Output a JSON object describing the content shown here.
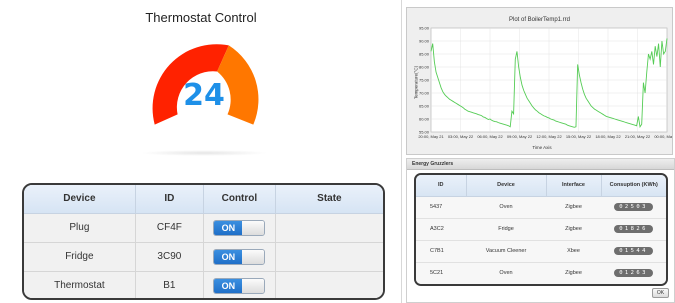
{
  "thermostat": {
    "title": "Thermostat Control",
    "value": "24",
    "gauge_fraction": 0.24
  },
  "device_table": {
    "headers": [
      "Device",
      "ID",
      "Control",
      "State"
    ],
    "rows": [
      {
        "device": "Plug",
        "id": "CF4F",
        "control": "ON",
        "state": ""
      },
      {
        "device": "Fridge",
        "id": "3C90",
        "control": "ON",
        "state": ""
      },
      {
        "device": "Thermostat",
        "id": "B1",
        "control": "ON",
        "state": ""
      }
    ]
  },
  "plot": {
    "title": "Plot of BoilerTemp1.rrd",
    "ylabel": "Temperature(°C)",
    "xlabel": "Time Axis",
    "yticks": [
      "95.00",
      "90.00",
      "85.00",
      "80.00",
      "75.00",
      "70.00",
      "65.00",
      "60.00",
      "55.00"
    ],
    "xticks": [
      "20:00, May 21",
      "03:00, May 22",
      "06:00, May 22",
      "09:00, May 22",
      "12:00, May 22",
      "15:00, May 22",
      "18:00, May 22",
      "21:00, May 22",
      "00:00, May 23"
    ]
  },
  "chart_data": {
    "type": "line",
    "title": "Plot of BoilerTemp1.rrd",
    "xlabel": "Time Axis",
    "ylabel": "Temperature(°C)",
    "ylim": [
      55,
      95
    ],
    "series": [
      {
        "values": [
          86,
          89,
          82,
          78,
          76,
          74,
          72,
          70.5,
          69.5,
          68.8,
          68.2,
          67.6,
          67.2,
          66.8,
          66.4,
          66,
          65.6,
          65.2,
          64.8,
          64.4,
          63.8,
          63.4,
          63,
          62.8,
          62.6,
          62.4,
          62.2,
          62,
          61.7,
          61.5,
          61.3,
          60.8,
          60.6,
          60.2,
          59.8,
          60,
          59.5,
          59.2,
          59,
          58.9,
          58.6,
          58.4,
          58.2,
          58,
          57.8,
          57.6,
          57.4,
          57,
          63,
          62,
          83,
          86,
          80,
          76,
          73,
          71,
          69.5,
          68,
          67,
          66,
          65,
          64.2,
          63.5,
          63,
          62.4,
          62,
          61.6,
          61.2,
          61,
          60.6,
          60.4,
          60,
          59.8,
          59.6,
          59.2,
          59,
          58.8,
          58.6,
          58.4,
          58.2,
          58,
          57.6,
          57.4,
          57.2,
          57,
          56.8,
          57,
          81,
          77,
          74,
          71.5,
          69.5,
          68,
          67,
          66,
          65,
          64.4,
          63.8,
          63.4,
          63,
          62.6,
          62.2,
          61.8,
          61.4,
          61,
          60.8,
          60.6,
          60.4,
          60.2,
          60,
          59.8,
          59.6,
          59.4,
          59.2,
          59,
          58.8,
          58.6,
          58.4,
          58.2,
          58,
          57.8,
          57.6,
          57.4,
          61,
          57,
          58,
          74,
          70,
          78,
          85,
          83,
          86,
          81,
          88,
          84,
          89,
          80,
          90,
          85,
          86,
          91
        ]
      }
    ]
  },
  "energy": {
    "title": "Energy Gruzzlers",
    "headers": [
      "ID",
      "Device",
      "Interface",
      "Consuption (KWh)"
    ],
    "rows": [
      {
        "id": "5437",
        "device": "Oven",
        "interface": "Zigbee",
        "consumption": "02503"
      },
      {
        "id": "A3C2",
        "device": "Fridge",
        "interface": "Zigbee",
        "consumption": "01826"
      },
      {
        "id": "C7B1",
        "device": "Vacuum Cleener",
        "interface": "Xbee",
        "consumption": "01544"
      },
      {
        "id": "5C21",
        "device": "Oven",
        "interface": "Zigbee",
        "consumption": "01263"
      }
    ],
    "ok_label": "OK"
  },
  "colors": {
    "gauge_red": "#ff2200",
    "gauge_orange": "#ff7700",
    "value_blue": "#1e90e8",
    "line_green": "#55cc55",
    "switch_blue": "#2a7fd8"
  }
}
